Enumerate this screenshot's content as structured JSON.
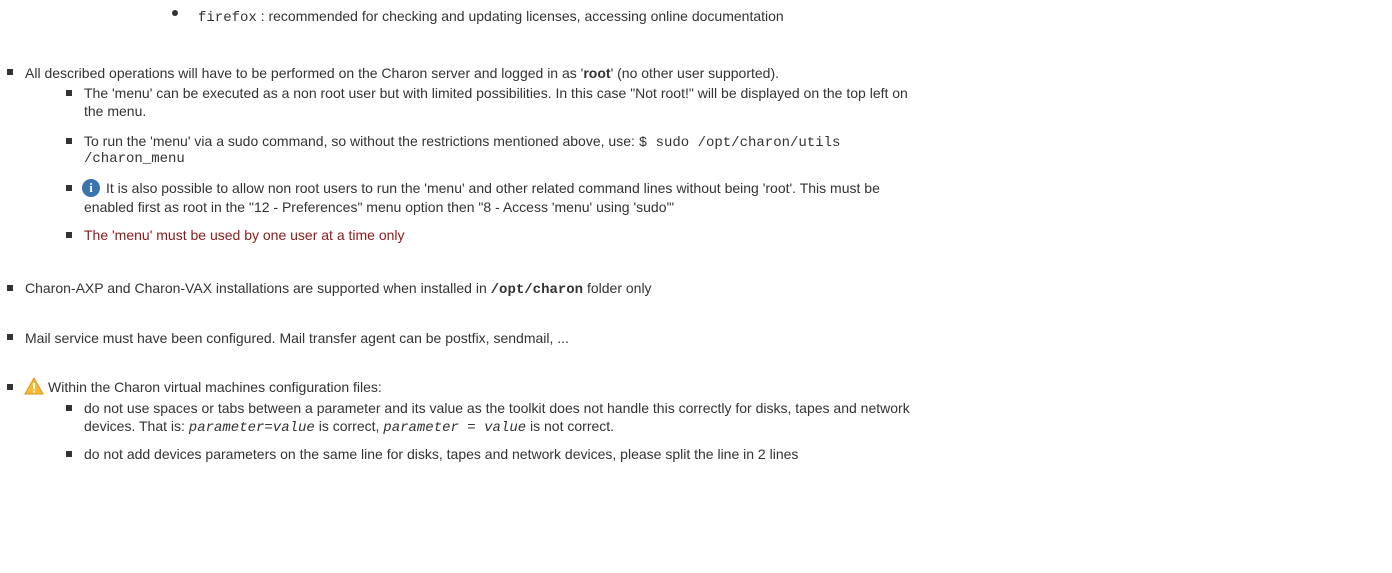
{
  "colors": {
    "text": "#333333",
    "warning_text": "#8b1a1a",
    "info_icon": "#3b73af",
    "warning_icon": "#f5b932"
  },
  "icons": {
    "info": "info-icon",
    "warning": "warning-icon"
  },
  "firefox_item": {
    "cmd": "firefox",
    "text": " : recommended for checking and updating licenses, accessing online documentation"
  },
  "root_item": {
    "pre": "All described operations will have to be performed on the Charon server and logged in as '",
    "bold": "root",
    "post": "' (no other user supported).",
    "sub": {
      "non_root_line1": "The 'menu' can be executed as a non root user but with limited possibilities. In this case \"Not root!\" will be displayed on the top left on",
      "non_root_line2": "the menu.",
      "sudo_text": "To run the 'menu' via a sudo command, so without the restrictions mentioned above, use: ",
      "sudo_cmd1": "$ sudo /opt/charon/utils",
      "sudo_cmd2": "/charon_menu",
      "info_line1": "It is also possible to allow non root users to run the 'menu' and other related command lines without being 'root'. This must be",
      "info_line2": "enabled first as root in the \"12 - Preferences\" menu option then \"8 - Access 'menu' using 'sudo'\"",
      "one_user": "The 'menu' must be used by one user at a time only"
    }
  },
  "install_item": {
    "pre": "Charon-AXP and Charon-VAX installations are supported when installed in ",
    "path": "/opt/charon",
    "post": " folder only"
  },
  "mail_item": {
    "text": "Mail service must have been configured. Mail transfer agent can be postfix, sendmail, ..."
  },
  "config_item": {
    "text": "Within the Charon virtual machines configuration files:",
    "sub": {
      "spaces_line1": "do not use spaces or tabs between a parameter and its value as the toolkit does not handle this correctly for disks, tapes and network",
      "spaces_pre": "devices. That is: ",
      "good_example": "parameter=value",
      "mid": " is correct, ",
      "bad_example": "parameter = value",
      "spaces_post": " is not correct.",
      "split_line": "do not add devices parameters on the same line for disks, tapes and network devices, please split the line in 2 lines"
    }
  }
}
